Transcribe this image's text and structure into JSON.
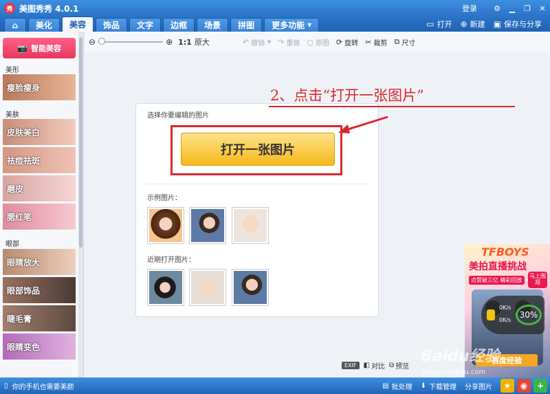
{
  "app": {
    "logo": "秀",
    "title": "美图秀秀 4.0.1"
  },
  "titlebar": {
    "login": "登录",
    "window_buttons": [
      "settings-icon",
      "minimize-icon",
      "restore-icon",
      "close-icon"
    ]
  },
  "tabs": [
    {
      "label": "",
      "icon": "home-icon"
    },
    {
      "label": "美化"
    },
    {
      "label": "美容",
      "active": true
    },
    {
      "label": "饰品"
    },
    {
      "label": "文字"
    },
    {
      "label": "边框"
    },
    {
      "label": "场景"
    },
    {
      "label": "拼图"
    },
    {
      "label": "更多功能",
      "dropdown": true
    }
  ],
  "tab_actions": {
    "open": "打开",
    "new": "新建",
    "save_share": "保存与分享"
  },
  "sidebar": {
    "smart_button": "智能美容",
    "sections": [
      {
        "label": "美形",
        "items": [
          "瘦脸瘦身"
        ]
      },
      {
        "label": "美肤",
        "items": [
          "皮肤美白",
          "祛痘祛斑",
          "磨皮",
          "腮红笔"
        ]
      },
      {
        "label": "眼部",
        "items": [
          "眼睛放大",
          "眼部饰品",
          "睫毛膏",
          "眼睛变色"
        ]
      }
    ]
  },
  "toolbar": {
    "ratio": "1:1",
    "original_size": "原大",
    "undo": "撤销",
    "redo": "重做",
    "original": "原图",
    "rotate": "旋转",
    "crop": "裁剪",
    "size": "尺寸"
  },
  "panel": {
    "prompt": "选择你要编辑的图片",
    "open_button": "打开一张图片",
    "examples_label": "示例图片：",
    "recent_label": "近期打开图片："
  },
  "annotation": "2、点击“打开一张图片”",
  "canvas_bottom": {
    "exif": "EXIF",
    "compare": "对比",
    "preview": "预览"
  },
  "ad": {
    "title": "TFBOYS",
    "sub": "美拍直播挑战",
    "tag": "点赞破三亿 精彩回放",
    "badge": "马上围观",
    "cta": "百度经验",
    "speed_up": "0K/s",
    "speed_down": "0K/s",
    "percent": "30%"
  },
  "statusbar": {
    "left": "你的手机也需要美颜",
    "batch": "批处理",
    "download": "下载管理",
    "share": "分享图片"
  },
  "watermark": {
    "brand": "Baidu经验",
    "url": "jingyan.baidu.com"
  },
  "colors": {
    "accent": "#2b74c8",
    "annotation_red": "#d9282f",
    "open_button": "#f6b919",
    "smart_pink": "#e8385f"
  }
}
